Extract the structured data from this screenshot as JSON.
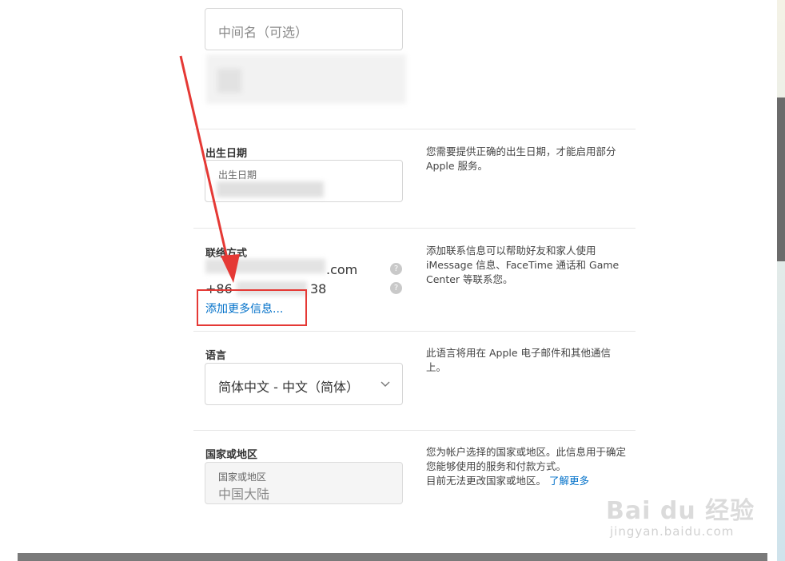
{
  "name_section": {
    "middle_name_placeholder": "中间名（可选）"
  },
  "birthday_section": {
    "label": "出生日期",
    "field_label": "出生日期",
    "help": "您需要提供正确的出生日期，才能启用部分 Apple 服务。"
  },
  "contact_section": {
    "label": "联络方式",
    "email_suffix": ".com",
    "phone_prefix": "+86",
    "phone_suffix": "38",
    "help_icon": "?",
    "add_more_link": "添加更多信息...",
    "help": "添加联系信息可以帮助好友和家人使用 iMessage 信息、FaceTime 通话和 Game Center 等联系您。"
  },
  "language_section": {
    "label": "语言",
    "selected_value": "简体中文 - 中文（简体）",
    "help": "此语言将用在 Apple 电子邮件和其他通信上。"
  },
  "country_section": {
    "label": "国家或地区",
    "field_label": "国家或地区",
    "field_value": "中国大陆",
    "help_line1": "您为帐户选择的国家或地区。此信息用于确定您能够使用的服务和付款方式。",
    "help_line2": "目前无法更改国家或地区。",
    "learn_more_link": "了解更多"
  },
  "watermark": {
    "brand": "Bai du 经验",
    "url": "jingyan.baidu.com"
  },
  "colors": {
    "link": "#0070c9",
    "annotation_red": "#e53935",
    "scrollbar": "#6b6b6b"
  }
}
